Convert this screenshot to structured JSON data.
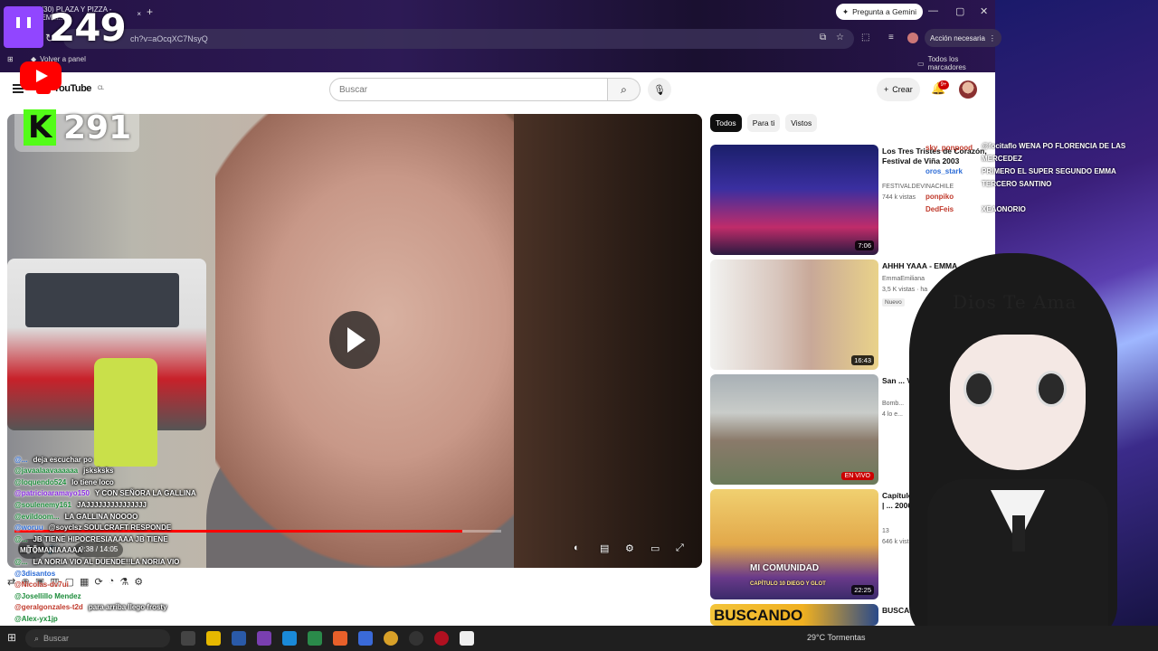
{
  "overlays": {
    "twitch_count": "249",
    "kick_count": "291"
  },
  "browser": {
    "tab_title": "(30) PLAZA Y PIZZA - EMM...",
    "gemini_label": "Pregunta a Gemini",
    "url": "ch?v=aOcqXC7NsyQ",
    "accion_label": "Acción necesaria",
    "bookmark_panel": "Volver a panel",
    "bookmark_all": "Todos los marcadores"
  },
  "youtube": {
    "logo_text": "YouTube",
    "country": "CL",
    "search_placeholder": "Buscar",
    "crear_label": "Crear",
    "notif_count": "9+",
    "chips": [
      "Todos",
      "Para ti",
      "Vistos"
    ],
    "player": {
      "time": "9:38 / 14:05",
      "progress": 0.92
    },
    "recommendations": [
      {
        "title": "Los Tres Tristes de Corazón, Festival de Viña 2003",
        "channel": "FESTIVALDEVINACHILE",
        "views": "744 k vistas",
        "duration": "7:06",
        "live": false,
        "nuevo": ""
      },
      {
        "title": "AHHH YAAA - EMMA",
        "channel": "EmmaEmiliana",
        "views": "3,5 K vistas · ha",
        "duration": "16:43",
        "live": false,
        "nuevo": "Nuevo"
      },
      {
        "title": "San ... VIVO",
        "channel": "Bomb...",
        "views": "4 lo e...",
        "duration": "",
        "live": true,
        "live_label": "EN VIVO",
        "nuevo": ""
      },
      {
        "title": "Capítulo 10: M... Diego y Glot | ... 2006",
        "channel": "13",
        "views": "646 k vistas · ha",
        "duration": "22:25",
        "live": false,
        "nuevo": ""
      },
      {
        "title": "BUSCA...",
        "channel": "",
        "views": "",
        "duration": "",
        "live": false,
        "nuevo": ""
      }
    ],
    "thumb_text": {
      "mi_comunidad": "MI COMUNIDAD",
      "capitulo": "CAPÍTULO 10  DIEGO Y GLOT",
      "buscando": "BUSCANDO"
    }
  },
  "chat_left": [
    {
      "user": "@...",
      "msg": "deja escuchar po",
      "color": "#2b6bd6"
    },
    {
      "user": "@javaalaavaaaaaa",
      "msg": "jsksksks",
      "color": "#1c8c3a"
    },
    {
      "user": "@loquendo524",
      "msg": "lo tiene loco",
      "color": "#1c8c3a"
    },
    {
      "user": "@patricioaramayo150",
      "msg": "Y CON SEÑORA LA GALLINA",
      "color": "#8a2be2"
    },
    {
      "user": "@soulenemy161",
      "msg": "JAJJJJJJJJJJJJJJJ",
      "color": "#1c8c3a"
    },
    {
      "user": "@evildoom...",
      "msg": "LA GALLINA NOOOO",
      "color": "#1c8c3a"
    },
    {
      "user": "@woruu",
      "msg": "@soyclsz SOULCRAFT RESPONDE",
      "color": "#2b6bd6"
    },
    {
      "user": "@...",
      "msg": "JB TIENE HIPOCRESIAAAAA JB TIENE",
      "color": "#1c8c3a"
    },
    {
      "user": "",
      "msg": "MITOMANIAAAAA",
      "color": "#1c8c3a"
    },
    {
      "user": "@...",
      "msg": "LA NORIA VIO AL DUENDE!!LA NORIA VIO",
      "color": "#1c8c3a"
    },
    {
      "user": "@3disantos",
      "msg": "",
      "color": "#2b6bd6"
    },
    {
      "user": "@Nicolas-dv7ui",
      "msg": "",
      "color": "#c0392b"
    },
    {
      "user": "@Josellillo Mendez",
      "msg": "",
      "color": "#1c8c3a"
    },
    {
      "user": "@geralgonzales-t2d",
      "msg": "para arriba llego frosty",
      "color": "#c0392b"
    },
    {
      "user": "@Alex-yx1jp",
      "msg": "",
      "color": "#1c8c3a"
    }
  ],
  "chat_right": [
    {
      "user": "sky_ponpood",
      "color": "#c0392b"
    },
    {
      "user": "oros_stark",
      "color": "#2b6bd6"
    },
    {
      "user": "ponpiko",
      "color": "#c0392b"
    },
    {
      "user": "DedFeis",
      "color": "#c0392b"
    }
  ],
  "chat_right_msgs": [
    "@focitaflo WENA PO FLORENCIA DE LAS",
    "MERCEDEZ",
    "PRIMERO EL SUPER SEGUNDO EMMA",
    "TERCERO SANTINO",
    "XEAONORIO"
  ],
  "vtuber": {
    "title": "Dios Te Ama"
  },
  "taskbar": {
    "search_placeholder": "Buscar",
    "weather": "29°C  Tormentas"
  }
}
